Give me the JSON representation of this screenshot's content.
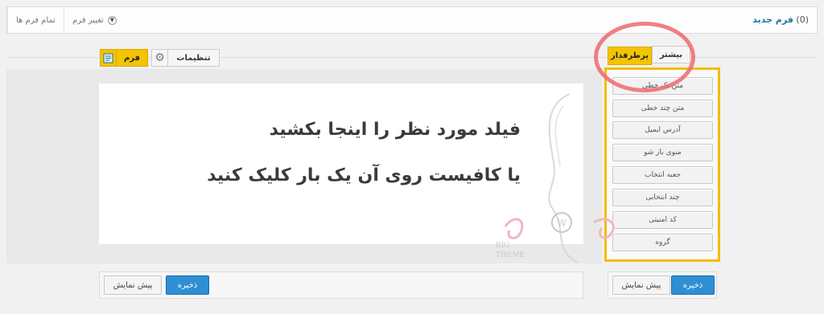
{
  "topbar": {
    "form_count": "(0)",
    "form_name": "فرم جدید",
    "change_form_label": "تغییر فرم",
    "all_forms_label": "تمام فرم ها"
  },
  "tabs": {
    "more": "بیشتر",
    "popular": "پرطرفدار"
  },
  "fields": [
    {
      "label": "متن تک خطی"
    },
    {
      "label": "متن چند خطی"
    },
    {
      "label": "آدرس ایمیل"
    },
    {
      "label": "منوی باز شو"
    },
    {
      "label": "جعبه انتخاب"
    },
    {
      "label": "چند انتخابی"
    },
    {
      "label": "کد امنیتی"
    },
    {
      "label": "گروه"
    }
  ],
  "toolbar": {
    "settings_label": "تنظیمات",
    "form_label": "فرم"
  },
  "canvas": {
    "line1": "فیلد مورد نظر را اینجا بکشید",
    "line2": "یا کافیست روی آن یک بار کلیک کنید"
  },
  "footer": {
    "save_label": "ذخیره",
    "preview_label": "پیش نمایش"
  },
  "watermark": {
    "text1": "BIG",
    "text2": "THEME"
  },
  "colors": {
    "accent_yellow": "#f6ba0b",
    "primary_blue": "#2e8fd5",
    "highlight_red": "#ee696e"
  }
}
